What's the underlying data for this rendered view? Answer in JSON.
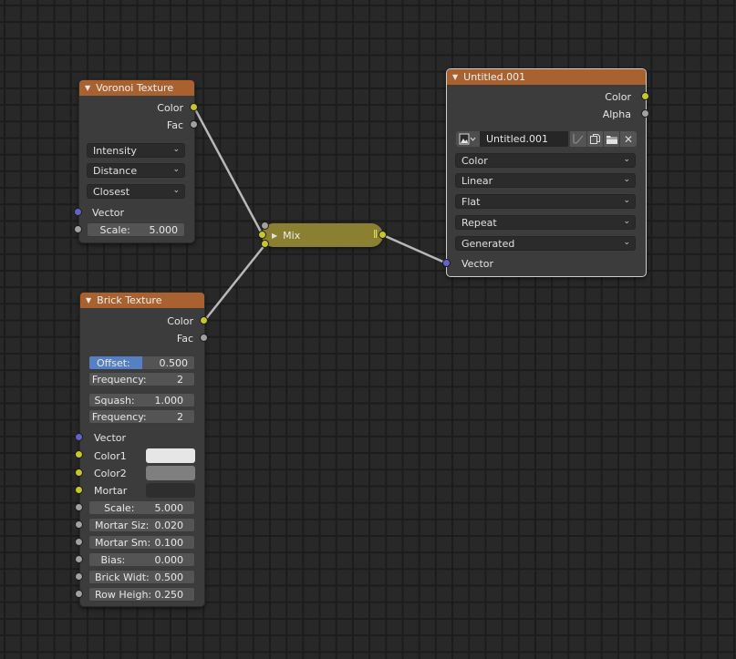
{
  "editor": "Node Editor",
  "links": [
    {
      "from": "voronoi.color",
      "to": "mix.color1"
    },
    {
      "from": "brick.color",
      "to": "mix.color2"
    },
    {
      "from": "mix.output",
      "to": "image.vector"
    }
  ],
  "voronoi": {
    "title": "Voronoi Texture",
    "outputs": [
      "Color",
      "Fac"
    ],
    "dropdowns": [
      "Intensity",
      "Distance",
      "Closest"
    ],
    "input_vector": "Vector",
    "scale": {
      "label": "Scale:",
      "value": "5.000"
    }
  },
  "brick": {
    "title": "Brick Texture",
    "outputs": [
      "Color",
      "Fac"
    ],
    "offset": {
      "label": "Offset:",
      "value": "0.500",
      "fraction": 0.5
    },
    "offset_frequency": {
      "label": "Frequency:",
      "value": "2"
    },
    "squash": {
      "label": "Squash:",
      "value": "1.000"
    },
    "squash_frequency": {
      "label": "Frequency:",
      "value": "2"
    },
    "vector": "Vector",
    "color1": {
      "label": "Color1",
      "color": "#e6e6e6"
    },
    "color2": {
      "label": "Color2",
      "color": "#7f7f7f"
    },
    "mortar": {
      "label": "Mortar",
      "color": "#2e2e2e"
    },
    "fields": [
      {
        "label": "Scale:",
        "value": "5.000"
      },
      {
        "label": "Mortar Siz:",
        "value": "0.020"
      },
      {
        "label": "Mortar Sm:",
        "value": "0.100"
      },
      {
        "label": "Bias:",
        "value": "0.000"
      },
      {
        "label": "Brick Widt:",
        "value": "0.500"
      },
      {
        "label": "Row Heigh:",
        "value": "0.250"
      }
    ]
  },
  "mix": {
    "title": "Mix",
    "collapsed": true
  },
  "image": {
    "title": "Untitled.001",
    "selected": true,
    "outputs": [
      "Color",
      "Alpha"
    ],
    "image_name": "Untitled.001",
    "dropdowns": [
      "Color",
      "Linear",
      "Flat",
      "Repeat",
      "Generated"
    ],
    "input_vector": "Vector"
  },
  "colors": {
    "header": "#a8612f",
    "mix": "#8b7f32",
    "socket_color": "#c7c729",
    "socket_float": "#a1a1a1",
    "socket_vector": "#6363c7",
    "slider_fill": "#5680c2"
  }
}
